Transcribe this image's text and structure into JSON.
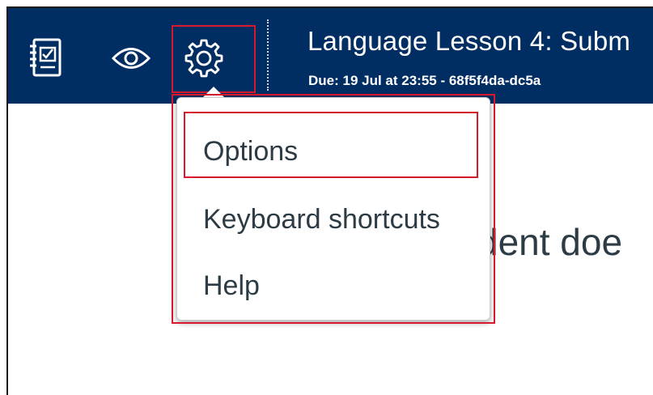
{
  "header": {
    "title": "Language Lesson 4: Subm",
    "subtitle": "Due: 19 Jul at 23:55 - 68f5f4da-dc5a",
    "icons": [
      "gradebook-icon",
      "eye-icon",
      "gear-icon"
    ]
  },
  "background": {
    "partial_text": "dent doe"
  },
  "settings_menu": {
    "items": [
      {
        "label": "Options"
      },
      {
        "label": "Keyboard shortcuts"
      },
      {
        "label": "Help"
      }
    ]
  },
  "colors": {
    "topbar": "#002d62",
    "highlight": "#d8192b",
    "text": "#2d3b45"
  }
}
